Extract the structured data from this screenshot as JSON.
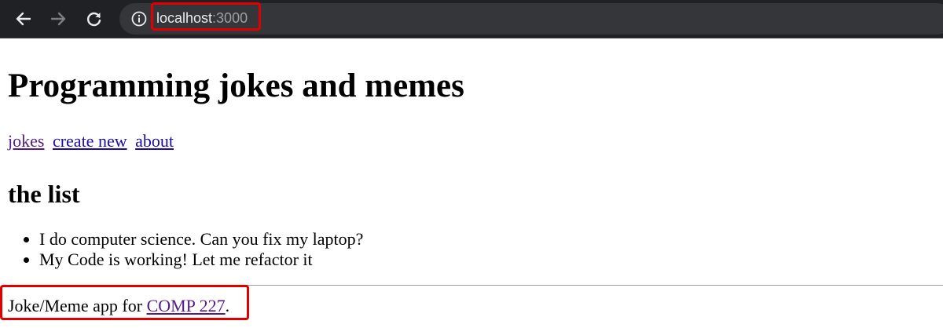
{
  "browser": {
    "url_host": "localhost",
    "url_port": ":3000",
    "icons": {
      "back": "arrow-left-icon",
      "forward": "arrow-right-icon",
      "reload": "reload-icon",
      "info": "info-icon"
    },
    "colors": {
      "toolbar_bg": "#202124",
      "omnibox_bg": "#35363a",
      "highlight": "#e00000"
    }
  },
  "page": {
    "title": "Programming jokes and memes",
    "nav": {
      "jokes": "jokes",
      "create_new": "create new",
      "about": "about"
    },
    "section_title": "the list",
    "items": [
      "I do computer science. Can you fix my laptop?",
      "My Code is working! Let me refactor it"
    ],
    "footer": {
      "prefix": "Joke/Meme app for ",
      "link": "COMP 227",
      "suffix": "."
    }
  }
}
